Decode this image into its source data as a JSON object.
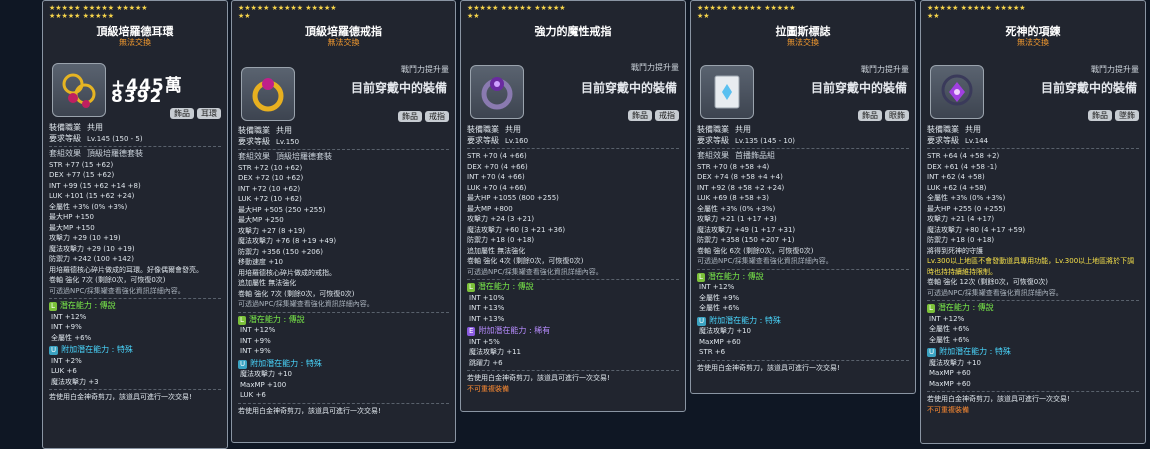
{
  "cards": [
    {
      "title": "頂級培羅德耳環",
      "trade_note": "無法交換",
      "big_number": "+445萬8392",
      "tags": [
        "飾品",
        "耳環"
      ],
      "job_label": "裝備職業",
      "job": "共用",
      "level_label": "要求等級",
      "level": "Lv.145 (150 - 5)",
      "set_label": "套組效果",
      "set_name": "頂級培羅德套裝",
      "stats": [
        "STR +77 (15 +62)",
        "DEX +77 (15 +62)",
        "INT +99 (15 +62 +14 +8)",
        "LUK +101 (15 +62 +24)",
        "全屬性 +3% (0% +3%)",
        "最大HP +150",
        "最大MP +150",
        "攻擊力 +29 (10 +19)",
        "魔法攻擊力 +29 (10 +19)",
        "防禦力 +242 (100 +142)"
      ],
      "desc": "用培羅德核心碎片做成的耳環。好像偶爾會發亮。",
      "scroll": "卷軸 強化 7次 (剩餘0次，可恢復0次)",
      "scroll_note": "可透過NPC/採集罐查看強化資訊詳細內容。",
      "pot_label": "潛在能力 : 傳說",
      "pot_lines": [
        "INT +12%",
        "INT +9%",
        "全屬性 +6%"
      ],
      "add_label": "附加潛在能力 : 特殊",
      "add_lines": [
        "INT +2%",
        "LUK +6",
        "魔法攻擊力 +3"
      ],
      "footer": "若使用白金神奇剪刀，該道具可進行一次交易!"
    },
    {
      "title": "頂級培羅德戒指",
      "trade_note": "無法交換",
      "cp_label": "戰鬥力提升量",
      "wearing": "目前穿戴中的裝備",
      "tags": [
        "飾品",
        "戒指"
      ],
      "job_label": "裝備職業",
      "job": "共用",
      "level_label": "要求等級",
      "level": "Lv.150",
      "set_label": "套組效果",
      "set_name": "頂級培羅德套裝",
      "stats": [
        "STR +72 (10 +62)",
        "DEX +72 (10 +62)",
        "INT +72 (10 +62)",
        "LUK +72 (10 +62)",
        "最大HP +505 (250 +255)",
        "最大MP +250",
        "攻擊力 +27 (8 +19)",
        "魔法攻擊力 +76 (8 +19 +49)",
        "防禦力 +356 (150 +206)",
        "移動速度 +10"
      ],
      "desc": "用培羅德核心碎片做成的戒指。",
      "extra1": "追加屬性 無法強化",
      "scroll": "卷軸 強化 7次 (剩餘0次，可恢復0次)",
      "scroll_note": "可透過NPC/採集罐查看強化資訊詳細內容。",
      "pot_label": "潛在能力 : 傳說",
      "pot_lines": [
        "INT +12%",
        "INT +9%",
        "INT +9%"
      ],
      "add_label": "附加潛在能力 : 特殊",
      "add_lines": [
        "魔法攻擊力 +10",
        "MaxMP +100",
        "LUK +6"
      ],
      "footer": "若使用白金神奇剪刀，該道具可進行一次交易!"
    },
    {
      "title": "強力的魔性戒指",
      "cp_label": "戰鬥力提升量",
      "wearing": "目前穿戴中的裝備",
      "tags": [
        "飾品",
        "戒指"
      ],
      "job_label": "裝備職業",
      "job": "共用",
      "level_label": "要求等級",
      "level": "Lv.160",
      "stats": [
        "STR +70 (4 +66)",
        "DEX +70 (4 +66)",
        "INT +70 (4 +66)",
        "LUK +70 (4 +66)",
        "最大HP +1055 (800 +255)",
        "最大MP +800",
        "攻擊力 +24 (3 +21)",
        "魔法攻擊力 +60 (3 +21 +36)",
        "防禦力 +18 (0 +18)"
      ],
      "extra1": "追加屬性 無法強化",
      "scroll": "卷軸 強化 4次 (剩餘0次，可恢復0次)",
      "scroll_note": "可透過NPC/採集罐查看強化資訊詳細內容。",
      "pot_label": "潛在能力 : 傳說",
      "pot_lines": [
        "INT +10%",
        "INT +13%",
        "INT +13%"
      ],
      "add_label": "附加潛在能力 : 稀有",
      "add_lines": [
        "INT +5%",
        "魔法攻擊力 +11",
        "跳躍力 +6"
      ],
      "footer": "若使用白金神奇剪刀，該道具可進行一次交易!",
      "warn": "不可重複裝備"
    },
    {
      "title": "拉圖斯標誌",
      "trade_note": "無法交換",
      "cp_label": "戰鬥力提升量",
      "wearing": "目前穿戴中的裝備",
      "tags": [
        "飾品",
        "眼飾"
      ],
      "job_label": "裝備職業",
      "job": "共用",
      "level_label": "要求等級",
      "level": "Lv.135 (145 - 10)",
      "set_label": "套組效果",
      "set_name": "首播飾品組",
      "stats": [
        "STR +70 (8 +58 +4)",
        "DEX +74 (8 +58 +4 +4)",
        "INT +92 (8 +58 +2 +24)",
        "LUK +69 (8 +58 +3)",
        "全屬性 +3% (0% +3%)",
        "攻擊力 +21 (1 +17 +3)",
        "魔法攻擊力 +49 (1 +17 +31)",
        "防禦力 +358 (150 +207 +1)"
      ],
      "scroll": "卷軸 強化 6次 (剩餘0次，可恢復0次)",
      "scroll_note": "可透過NPC/採集罐查看強化資訊詳細內容。",
      "pot_label": "潛在能力 : 傳說",
      "pot_lines": [
        "INT +12%",
        "全屬性 +9%",
        "全屬性 +6%"
      ],
      "add_label": "附加潛在能力 : 特殊",
      "add_lines": [
        "魔法攻擊力 +10",
        "MaxMP +60",
        "STR +6"
      ],
      "footer": "若使用白金神奇剪刀，該道具可進行一次交易!"
    },
    {
      "title": "死神的項鍊",
      "trade_note": "無法交換",
      "cp_label": "戰鬥力提升量",
      "wearing": "目前穿戴中的裝備",
      "tags": [
        "飾品",
        "墜飾"
      ],
      "job_label": "裝備職業",
      "job": "共用",
      "level_label": "要求等級",
      "level": "Lv.144",
      "stats": [
        "STR +64 (4 +58 +2)",
        "DEX +61 (4 +58 -1)",
        "INT +62 (4 +58)",
        "LUK +62 (4 +58)",
        "全屬性 +3% (0% +3%)",
        "最大HP +255 (0 +255)",
        "攻擊力 +21 (4 +17)",
        "魔法攻擊力 +80 (4 +17 +59)",
        "防禦力 +18 (0 +18)"
      ],
      "desc": "將得到死神的守護",
      "ynote": "Lv.300以上地區不會發動道具專用功能，Lv.300以上地區將於下調時也持持續維持限制。",
      "scroll": "卷軸 強化 12次 (剩餘0次，可恢復0次)",
      "scroll_note": "可透過NPC/採集罐查看強化資訊詳細內容。",
      "pot_label": "潛在能力 : 傳說",
      "pot_lines": [
        "INT +12%",
        "全屬性 +6%",
        "全屬性 +6%"
      ],
      "add_label": "附加潛在能力 : 特殊",
      "add_lines": [
        "魔法攻擊力 +10",
        "MaxMP +60",
        "MaxMP +60"
      ],
      "footer": "若使用白金神奇剪刀，該道具可進行一次交易!",
      "warn": "不可重複裝備"
    }
  ]
}
